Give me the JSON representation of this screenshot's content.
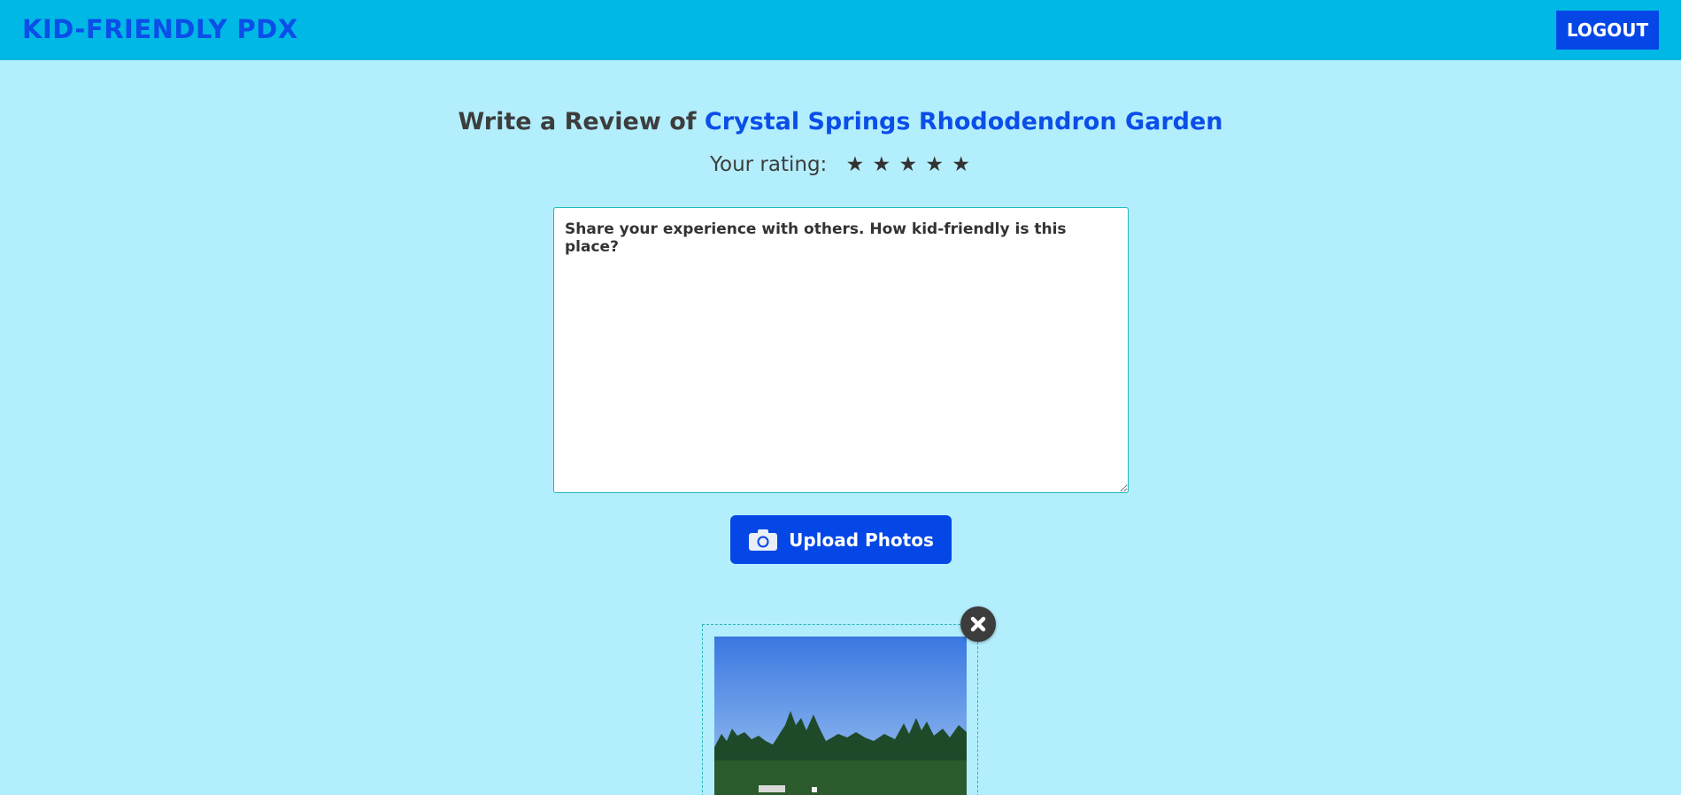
{
  "header": {
    "brand": "KID-FRIENDLY PDX",
    "logout_label": "LOGOUT"
  },
  "review": {
    "title_prefix": "Write a Review of",
    "place_name": "Crystal Springs Rhododendron Garden",
    "rating_label": "Your rating:",
    "stars": [
      "★",
      "★",
      "★",
      "★",
      "★"
    ],
    "textarea_placeholder": "Share your experience with others. How kid-friendly is this place?",
    "textarea_value": ""
  },
  "upload": {
    "label": "Upload Photos",
    "icon": "camera-icon"
  },
  "photo_preview": {
    "remove_icon": "close-icon",
    "image_content": "park-trees-sky"
  },
  "colors": {
    "background": "#b3eefd",
    "header": "#00b8e6",
    "brand": "#0b4ee8",
    "button": "#0547e6",
    "text": "#3d3d3d"
  }
}
